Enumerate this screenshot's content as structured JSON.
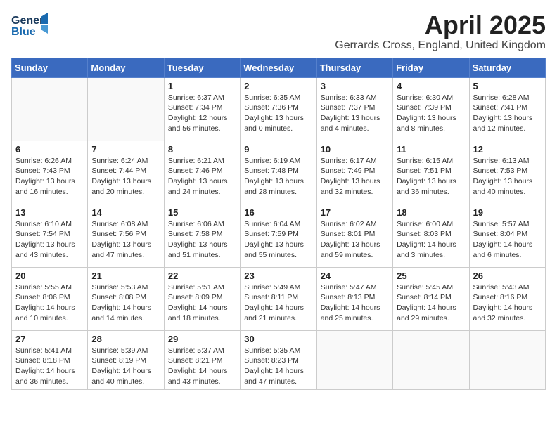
{
  "header": {
    "logo_general": "General",
    "logo_blue": "Blue",
    "month_title": "April 2025",
    "location": "Gerrards Cross, England, United Kingdom"
  },
  "days_of_week": [
    "Sunday",
    "Monday",
    "Tuesday",
    "Wednesday",
    "Thursday",
    "Friday",
    "Saturday"
  ],
  "weeks": [
    [
      {
        "day": "",
        "info": ""
      },
      {
        "day": "",
        "info": ""
      },
      {
        "day": "1",
        "info": "Sunrise: 6:37 AM\nSunset: 7:34 PM\nDaylight: 12 hours and 56 minutes."
      },
      {
        "day": "2",
        "info": "Sunrise: 6:35 AM\nSunset: 7:36 PM\nDaylight: 13 hours and 0 minutes."
      },
      {
        "day": "3",
        "info": "Sunrise: 6:33 AM\nSunset: 7:37 PM\nDaylight: 13 hours and 4 minutes."
      },
      {
        "day": "4",
        "info": "Sunrise: 6:30 AM\nSunset: 7:39 PM\nDaylight: 13 hours and 8 minutes."
      },
      {
        "day": "5",
        "info": "Sunrise: 6:28 AM\nSunset: 7:41 PM\nDaylight: 13 hours and 12 minutes."
      }
    ],
    [
      {
        "day": "6",
        "info": "Sunrise: 6:26 AM\nSunset: 7:43 PM\nDaylight: 13 hours and 16 minutes."
      },
      {
        "day": "7",
        "info": "Sunrise: 6:24 AM\nSunset: 7:44 PM\nDaylight: 13 hours and 20 minutes."
      },
      {
        "day": "8",
        "info": "Sunrise: 6:21 AM\nSunset: 7:46 PM\nDaylight: 13 hours and 24 minutes."
      },
      {
        "day": "9",
        "info": "Sunrise: 6:19 AM\nSunset: 7:48 PM\nDaylight: 13 hours and 28 minutes."
      },
      {
        "day": "10",
        "info": "Sunrise: 6:17 AM\nSunset: 7:49 PM\nDaylight: 13 hours and 32 minutes."
      },
      {
        "day": "11",
        "info": "Sunrise: 6:15 AM\nSunset: 7:51 PM\nDaylight: 13 hours and 36 minutes."
      },
      {
        "day": "12",
        "info": "Sunrise: 6:13 AM\nSunset: 7:53 PM\nDaylight: 13 hours and 40 minutes."
      }
    ],
    [
      {
        "day": "13",
        "info": "Sunrise: 6:10 AM\nSunset: 7:54 PM\nDaylight: 13 hours and 43 minutes."
      },
      {
        "day": "14",
        "info": "Sunrise: 6:08 AM\nSunset: 7:56 PM\nDaylight: 13 hours and 47 minutes."
      },
      {
        "day": "15",
        "info": "Sunrise: 6:06 AM\nSunset: 7:58 PM\nDaylight: 13 hours and 51 minutes."
      },
      {
        "day": "16",
        "info": "Sunrise: 6:04 AM\nSunset: 7:59 PM\nDaylight: 13 hours and 55 minutes."
      },
      {
        "day": "17",
        "info": "Sunrise: 6:02 AM\nSunset: 8:01 PM\nDaylight: 13 hours and 59 minutes."
      },
      {
        "day": "18",
        "info": "Sunrise: 6:00 AM\nSunset: 8:03 PM\nDaylight: 14 hours and 3 minutes."
      },
      {
        "day": "19",
        "info": "Sunrise: 5:57 AM\nSunset: 8:04 PM\nDaylight: 14 hours and 6 minutes."
      }
    ],
    [
      {
        "day": "20",
        "info": "Sunrise: 5:55 AM\nSunset: 8:06 PM\nDaylight: 14 hours and 10 minutes."
      },
      {
        "day": "21",
        "info": "Sunrise: 5:53 AM\nSunset: 8:08 PM\nDaylight: 14 hours and 14 minutes."
      },
      {
        "day": "22",
        "info": "Sunrise: 5:51 AM\nSunset: 8:09 PM\nDaylight: 14 hours and 18 minutes."
      },
      {
        "day": "23",
        "info": "Sunrise: 5:49 AM\nSunset: 8:11 PM\nDaylight: 14 hours and 21 minutes."
      },
      {
        "day": "24",
        "info": "Sunrise: 5:47 AM\nSunset: 8:13 PM\nDaylight: 14 hours and 25 minutes."
      },
      {
        "day": "25",
        "info": "Sunrise: 5:45 AM\nSunset: 8:14 PM\nDaylight: 14 hours and 29 minutes."
      },
      {
        "day": "26",
        "info": "Sunrise: 5:43 AM\nSunset: 8:16 PM\nDaylight: 14 hours and 32 minutes."
      }
    ],
    [
      {
        "day": "27",
        "info": "Sunrise: 5:41 AM\nSunset: 8:18 PM\nDaylight: 14 hours and 36 minutes."
      },
      {
        "day": "28",
        "info": "Sunrise: 5:39 AM\nSunset: 8:19 PM\nDaylight: 14 hours and 40 minutes."
      },
      {
        "day": "29",
        "info": "Sunrise: 5:37 AM\nSunset: 8:21 PM\nDaylight: 14 hours and 43 minutes."
      },
      {
        "day": "30",
        "info": "Sunrise: 5:35 AM\nSunset: 8:23 PM\nDaylight: 14 hours and 47 minutes."
      },
      {
        "day": "",
        "info": ""
      },
      {
        "day": "",
        "info": ""
      },
      {
        "day": "",
        "info": ""
      }
    ]
  ]
}
